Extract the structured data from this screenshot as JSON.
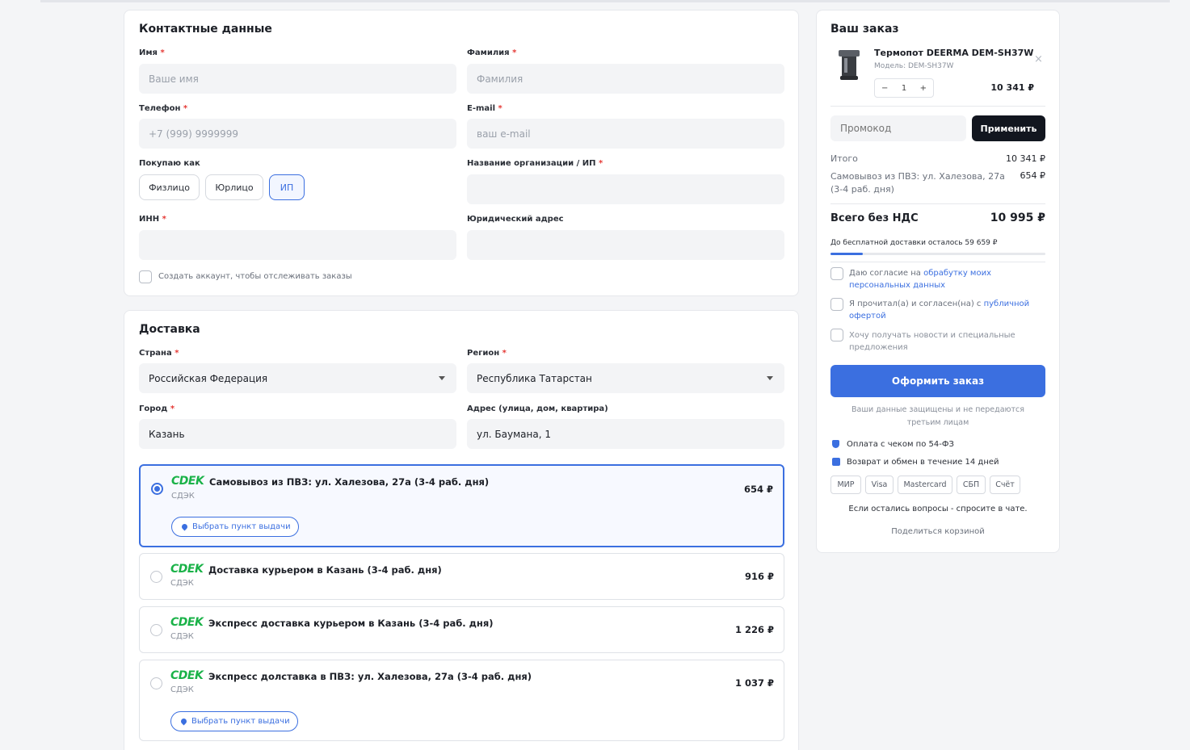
{
  "contacts": {
    "title": "Контактные данные",
    "first_name": {
      "label": "Имя",
      "placeholder": "Ваше имя"
    },
    "last_name": {
      "label": "Фамилия",
      "placeholder": "Фамилия"
    },
    "phone": {
      "label": "Телефон",
      "placeholder": "+7 (999) 9999999"
    },
    "email": {
      "label": "E-mail",
      "placeholder": "ваш e-mail"
    },
    "buyer_type": {
      "label": "Покупаю как",
      "options": [
        "Физлицо",
        "Юрлицо",
        "ИП"
      ],
      "selected": "ИП"
    },
    "org_name": {
      "label": "Название организации / ИП"
    },
    "inn": {
      "label": "ИНН"
    },
    "legal_address": {
      "label": "Юридический адрес"
    },
    "create_account": "Создать аккаунт, чтобы отслеживать заказы"
  },
  "delivery": {
    "title": "Доставка",
    "country": {
      "label": "Страна",
      "value": "Российская Федерация"
    },
    "region": {
      "label": "Регион",
      "value": "Республика Татарстан"
    },
    "city": {
      "label": "Город",
      "value": "Казань"
    },
    "address": {
      "label": "Адрес (улица, дом, квартира)",
      "value": "ул. Баумана, 1"
    },
    "logo_text": "CDEK",
    "pick_point_label": "Выбрать пункт выдачи",
    "options": [
      {
        "title": "Самовывоз из ПВЗ: ул. Халезова, 27а (3-4 раб. дня)",
        "carrier": "СДЭК",
        "price": "654 ₽",
        "selected": true
      },
      {
        "title": "Доставка курьером в Казань (3-4 раб. дня)",
        "carrier": "СДЭК",
        "price": "916 ₽",
        "selected": false
      },
      {
        "title": "Экспресс доставка курьером в Казань (3-4 раб. дня)",
        "carrier": "СДЭК",
        "price": "1 226 ₽",
        "selected": false
      },
      {
        "title": "Экспресс долставка в ПВЗ: ул. Халезова, 27а (3-4 раб. дня)",
        "carrier": "СДЭК",
        "price": "1 037 ₽",
        "selected": false
      }
    ]
  },
  "order": {
    "title": "Ваш заказ",
    "product": {
      "name": "Термопот DEERMA DEM-SH37W",
      "model": "Модель: DEM-SH37W",
      "qty": "1",
      "price": "10 341 ₽",
      "minus": "−",
      "plus": "+",
      "remove": "×"
    },
    "promo": {
      "placeholder": "Промокод",
      "apply": "Применить"
    },
    "subtotal": {
      "label": "Итого",
      "value": "10 341 ₽"
    },
    "shipping": {
      "label": "Самовывоз из ПВЗ: ул. Халезова, 27а (3-4 раб. дня)",
      "value": "654 ₽"
    },
    "total": {
      "label": "Всего без НДС",
      "value": "10 995 ₽"
    },
    "free_shipping": {
      "text": "До бесплатной доставки осталось 59 659 ₽",
      "progress": 0.15
    },
    "consents": {
      "c1_prefix": "Даю согласие на ",
      "c1_link": "обрабутку моих персональных данных",
      "c2_prefix": "Я прочитал(а) и согласен(на) с ",
      "c2_link": "публичной офертой",
      "c3": "Хочу получать новости и специальные предложения"
    },
    "submit": "Оформить заказ",
    "secure_note": "Ваши данные защищены и не передаются третьим лицам",
    "receipt": "Оплата с чеком по 54-ФЗ",
    "returns": "Возврат и обмен в течение 14 дней",
    "payments": [
      "МИР",
      "Visa",
      "Mastercard",
      "СБП",
      "Счёт"
    ],
    "questions": "Если остались вопросы - спросите в чате.",
    "share": "Поделиться корзиной"
  },
  "colors": {
    "accent": "#3b6fe0",
    "cdek": "#1ab248",
    "dark_button": "#12161f",
    "required": "#e53935"
  }
}
